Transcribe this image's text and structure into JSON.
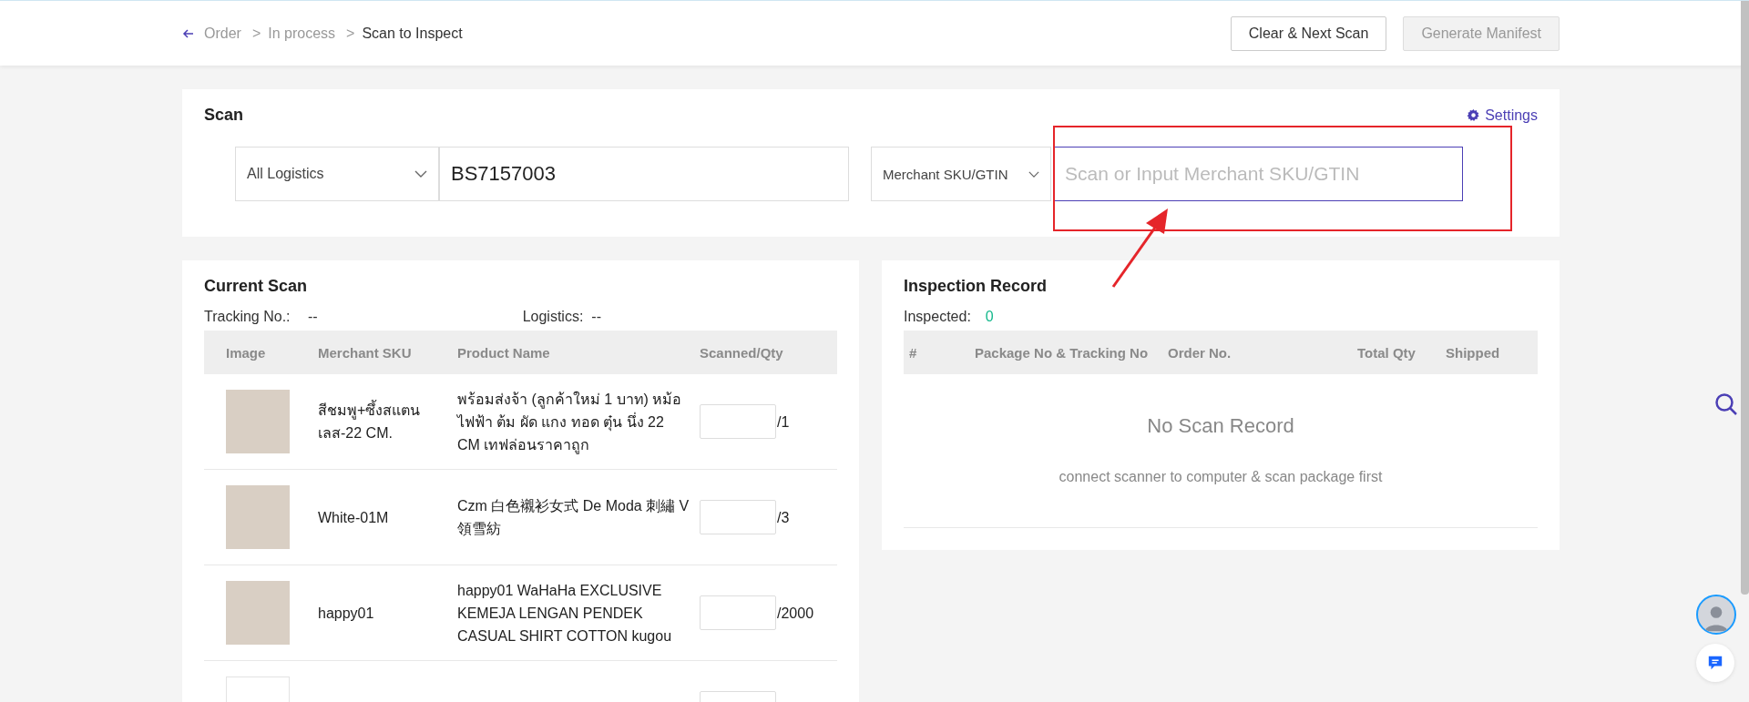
{
  "breadcrumb": [
    {
      "label": "Order",
      "current": false
    },
    {
      "label": "In process",
      "current": false
    },
    {
      "label": "Scan to Inspect",
      "current": true
    }
  ],
  "breadcrumb_separator": ">",
  "header_buttons": [
    {
      "label": "Clear & Next Scan",
      "disabled": false
    },
    {
      "label": "Generate Manifest",
      "disabled": true
    }
  ],
  "scan": {
    "title": "Scan",
    "settings": "Settings",
    "logistics_select": "All Logistics",
    "tracking_value": "BS7157003",
    "sku_select": "Merchant SKU/GTIN",
    "sku_placeholder": "Scan or Input Merchant SKU/GTIN"
  },
  "current_scan": {
    "title": "Current Scan",
    "tracking_label": "Tracking No.:",
    "tracking_value": "--",
    "logistics_label": "Logistics:",
    "logistics_value": "--",
    "columns": [
      "Image",
      "Merchant SKU",
      "Product Name",
      "Scanned/Qty"
    ],
    "rows": [
      {
        "kind": "photo",
        "sku": "สีชมพู+ซึ้งสแตนเลส-22 CM.",
        "name": "พร้อมส่งจ้า (ลูกค้าใหม่ 1 บาท) หม้อไฟฟ้า ต้ม ผัด แกง ทอด ตุ๋น นึ่ง 22 CM เทฟล่อนราคาถูก",
        "qty": "/1"
      },
      {
        "kind": "photo",
        "sku": "White-01M",
        "name": "Czm 白色襯衫女式 De Moda 刺繡 V 領雪紡",
        "qty": "/3"
      },
      {
        "kind": "photo",
        "sku": "happy01",
        "name": "happy01 WaHaHa EXCLUSIVE KEMEJA LENGAN PENDEK CASUAL SHIRT COTTON kugou",
        "qty": "/2000"
      },
      {
        "kind": "placeholder"
      }
    ]
  },
  "inspection": {
    "title": "Inspection Record",
    "inspected_label": "Inspected:",
    "inspected_value": "0",
    "columns": [
      "#",
      "Package No & Tracking No",
      "Order No.",
      "Total Qty",
      "Shipped"
    ],
    "empty_title": "No Scan Record",
    "empty_hint": "connect scanner to computer & scan package first"
  }
}
